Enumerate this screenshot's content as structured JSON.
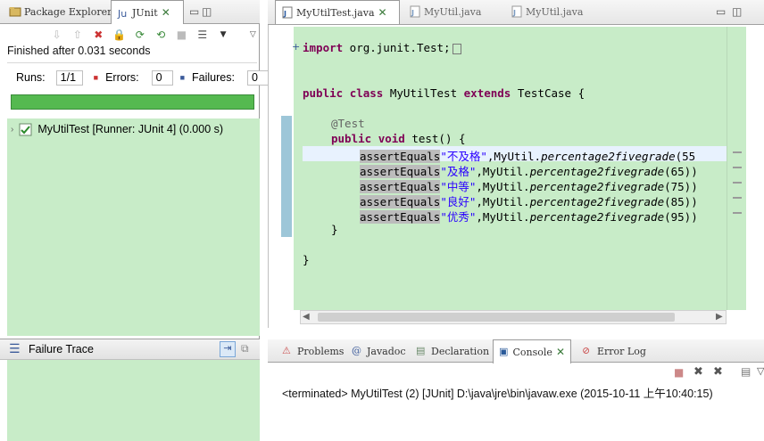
{
  "junit_view": {
    "tabs": [
      {
        "label": "Package Explorer"
      },
      {
        "label": "JUnit"
      }
    ],
    "status": "Finished after 0.031 seconds",
    "runs_label": "Runs:",
    "runs_value": "1/1",
    "errors_label": "Errors:",
    "errors_value": "0",
    "failures_label": "Failures:",
    "failures_value": "0",
    "progress_fraction": 1.0,
    "progress_color": "#55b950",
    "tree_item": "MyUtilTest [Runner: JUnit 4] (0.000 s)",
    "failure_trace_title": "Failure Trace",
    "pane_bg_color": "#c8ecc8"
  },
  "editor": {
    "tabs": [
      {
        "label": "MyUtilTest.java",
        "active": true
      },
      {
        "label": "MyUtil.java",
        "active": false
      },
      {
        "label": "MyUtil.java",
        "active": false
      }
    ],
    "lines": {
      "import_kw": "import",
      "import_rest": " org.junit.Test;",
      "class_public": "public",
      "class_class": "class",
      "class_name": " MyUtilTest ",
      "class_extends": "extends",
      "class_rest": " TestCase {",
      "annotation": "@Test",
      "method_public": "public",
      "method_void": "void",
      "method_rest": " test() {",
      "asserts": [
        {
          "fn": "assertEquals",
          "str": "\"不及格\"",
          "rest": ",MyUtil.",
          "call": "percentage2fivegrade",
          "arg": "(55"
        },
        {
          "fn": "assertEquals",
          "str": "\"及格\"",
          "rest": ",MyUtil.",
          "call": "percentage2fivegrade",
          "arg": "(65))"
        },
        {
          "fn": "assertEquals",
          "str": "\"中等\"",
          "rest": ",MyUtil.",
          "call": "percentage2fivegrade",
          "arg": "(75))"
        },
        {
          "fn": "assertEquals",
          "str": "\"良好\"",
          "rest": ",MyUtil.",
          "call": "percentage2fivegrade",
          "arg": "(85))"
        },
        {
          "fn": "assertEquals",
          "str": "\"优秀\"",
          "rest": ",MyUtil.",
          "call": "percentage2fivegrade",
          "arg": "(95))"
        }
      ],
      "close_method": "}",
      "close_class": "}"
    }
  },
  "bottom": {
    "tabs": [
      {
        "label": "Problems"
      },
      {
        "label": "Javadoc"
      },
      {
        "label": "Declaration"
      },
      {
        "label": "Console"
      },
      {
        "label": "Error Log"
      }
    ],
    "console_text": "<terminated> MyUtilTest (2) [JUnit] D:\\java\\jre\\bin\\javaw.exe (2015-10-11 上午10:40:15)"
  },
  "icons": [
    "junit-icon",
    "package-explorer-icon",
    "java-file-icon",
    "problems-icon",
    "javadoc-icon",
    "declaration-icon",
    "console-icon",
    "error-log-icon",
    "terminate-icon",
    "remove-launch-icon",
    "remove-all-icon",
    "test-suite-icon"
  ]
}
